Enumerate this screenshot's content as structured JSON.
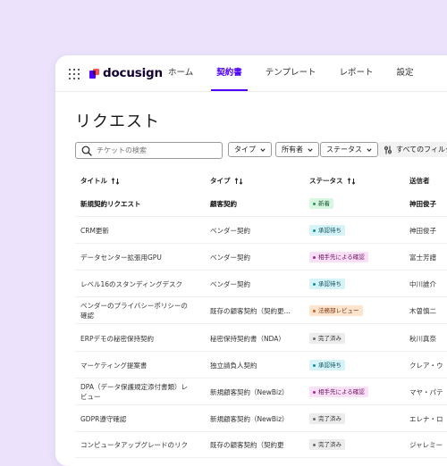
{
  "app": {
    "logo_text": "docusign"
  },
  "nav": [
    {
      "label": "ホーム",
      "active": false
    },
    {
      "label": "契約書",
      "active": true
    },
    {
      "label": "テンプレート",
      "active": false
    },
    {
      "label": "レポート",
      "active": false
    },
    {
      "label": "設定",
      "active": false
    }
  ],
  "page": {
    "title": "リクエスト"
  },
  "search": {
    "placeholder": "チケットの検索",
    "value": ""
  },
  "filters": {
    "type": "タイプ",
    "owner": "所有者",
    "status": "ステータス",
    "all": "すべてのフィルタ"
  },
  "table": {
    "headers": {
      "title": "タイトル",
      "type": "タイプ",
      "status": "ステータス",
      "sender": "送信者"
    },
    "rows": [
      {
        "title": "新規契約リクエスト",
        "title2": "",
        "type": "顧客契約",
        "status": "新着",
        "status_kind": "new",
        "sender": "神田俊子",
        "bold": true
      },
      {
        "title": "CRM更新",
        "title2": "",
        "type": "ベンダー契約",
        "status": "承認待ち",
        "status_kind": "pending",
        "sender": "神田俊子",
        "bold": false
      },
      {
        "title": "データセンター拡張用GPU",
        "title2": "",
        "type": "ベンダー契約",
        "status": "相手先による確認",
        "status_kind": "review",
        "sender": "富士芳譜",
        "bold": false
      },
      {
        "title": "レベル16のスタンディングデスク",
        "title2": "",
        "type": "ベンダー契約",
        "status": "承認待ち",
        "status_kind": "pending",
        "sender": "中川誰介",
        "bold": false
      },
      {
        "title": "ベンダーのプライバシーポリシーの",
        "title2": "確認",
        "type": "既存の顧客契約（契約更...",
        "status": "法務部レビュー",
        "status_kind": "legal",
        "sender": "木曽慎二",
        "bold": false
      },
      {
        "title": "ERPデモの秘密保持契約",
        "title2": "",
        "type": "秘密保持契約書（NDA）",
        "status": "完了済み",
        "status_kind": "done",
        "sender": "秋川真奈",
        "bold": false
      },
      {
        "title": "マーケティング提案書",
        "title2": "",
        "type": "独立請負人契約",
        "status": "承認待ち",
        "status_kind": "pending",
        "sender": "クレア・ウ",
        "bold": false
      },
      {
        "title": "DPA（データ保護規定添付書類）レ",
        "title2": "ビュー",
        "type": "新規顧客契約（NewBiz）",
        "status": "相手先による確認",
        "status_kind": "review",
        "sender": "マヤ・パテ",
        "bold": false
      },
      {
        "title": "GDPR遵守確認",
        "title2": "",
        "type": "新規顧客契約（NewBiz）",
        "status": "完了済み",
        "status_kind": "done",
        "sender": "エレナ・ロ",
        "bold": false
      },
      {
        "title": "コンピュータアップグレードのリク",
        "title2": "",
        "type": "既存の顧客契約（契約更",
        "status": "完了済み",
        "status_kind": "done",
        "sender": "ジャレミー",
        "bold": false
      }
    ]
  },
  "colors": {
    "accent": "#4c00ff",
    "background": "#ece2fb",
    "new": {
      "bg": "#d8f7e2",
      "dot": "#1f9d55",
      "text": "#14532d"
    },
    "pending": {
      "bg": "#d6f3f7",
      "dot": "#0e8fa4",
      "text": "#0b4f5c"
    },
    "review": {
      "bg": "#f9e0f6",
      "dot": "#b51f9a",
      "text": "#6d1160"
    },
    "legal": {
      "bg": "#fde4cf",
      "dot": "#d25e12",
      "text": "#7a3408"
    },
    "done": {
      "bg": "#ececec",
      "dot": "#6b6b6b",
      "text": "#333333"
    }
  },
  "icons": {
    "apps": "grid-icon",
    "search": "search-icon",
    "chevron": "chevron-down-icon",
    "filters": "sliders-icon",
    "sort": "sort-icon"
  }
}
